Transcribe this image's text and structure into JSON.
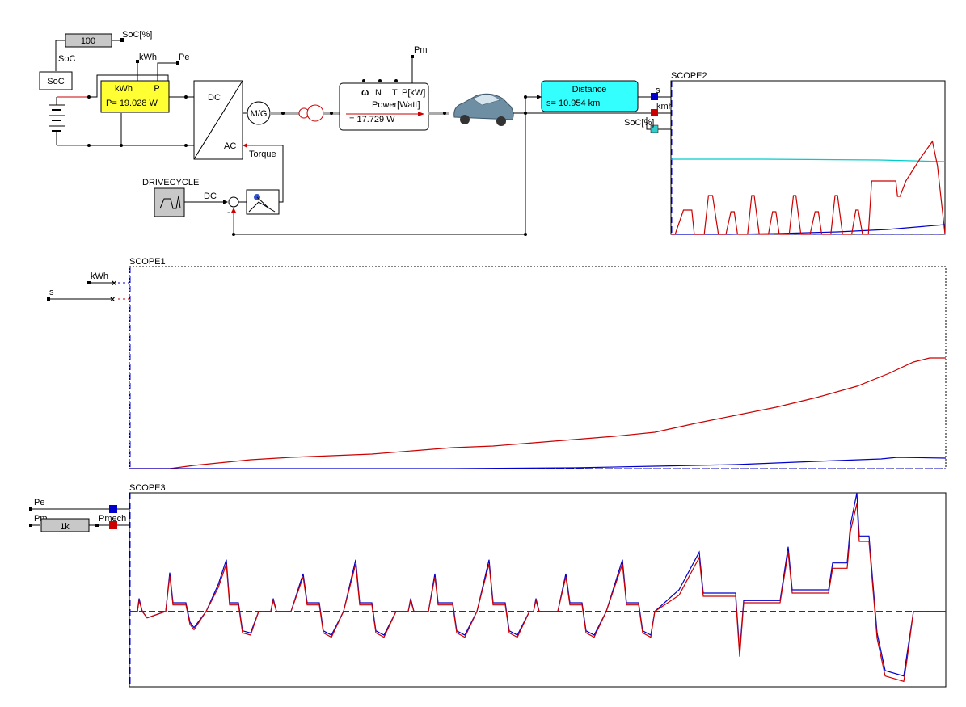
{
  "labels": {
    "soc_const": "100",
    "soc_pct_top": "SoC[%]",
    "soc_wire": "SoC",
    "soc_block": "SoC",
    "kwh_top": "kWh",
    "pe_top": "Pe",
    "meter_kwh": "kWh",
    "meter_p": "P",
    "meter_value": "P= 19.028 W",
    "conv_dc": "DC",
    "conv_ac": "AC",
    "motor": "M/G",
    "torque": "Torque",
    "pm_top": "Pm",
    "sensor_omega": "ω",
    "sensor_n": "N",
    "sensor_t": "T",
    "sensor_pkw": "P[kW]",
    "power_label": "Power[Watt]",
    "power_value": "= 17.729 W",
    "distance_title": "Distance",
    "distance_value": "s= 10.954 km",
    "out_s": "s",
    "out_kmh": "kmh",
    "out_soc": "SoC[%]",
    "drivecycle": "DRIVECYCLE",
    "dc_wire": "DC",
    "minus": "-",
    "scope1_in_kwh": "kWh",
    "scope1_in_s": "s",
    "scope3_in_pe": "Pe",
    "scope3_in_pm": "Pm",
    "scope3_gain": "1k",
    "scope3_in_pmech": "Pmech"
  },
  "colors": {
    "red": "#cc0000",
    "blue": "#0000cc",
    "cyan": "#00cccc",
    "meter_fill": "#ffff33",
    "distance_fill": "#33ffff",
    "gray_block": "#c8c8c8"
  },
  "chart_data": [
    {
      "type": "line",
      "title": "SCOPE2",
      "xlim": [
        0,
        329
      ],
      "ylim": [
        0,
        190
      ],
      "grid": false,
      "series": [
        {
          "color": "#00cccc",
          "points": [
            [
              0,
              93
            ],
            [
              110,
              93
            ],
            [
              250,
              92
            ],
            [
              329,
              90
            ]
          ]
        },
        {
          "color": "#0000cc",
          "points": [
            [
              0,
              0
            ],
            [
              70,
              0
            ],
            [
              130,
              1
            ],
            [
              200,
              3
            ],
            [
              260,
              6
            ],
            [
              329,
              12
            ]
          ]
        },
        {
          "color": "#cc0000",
          "points": [
            [
              0,
              0
            ],
            [
              5,
              0
            ],
            [
              15,
              30
            ],
            [
              25,
              30
            ],
            [
              28,
              0
            ],
            [
              40,
              0
            ],
            [
              45,
              48
            ],
            [
              50,
              48
            ],
            [
              57,
              0
            ],
            [
              66,
              0
            ],
            [
              72,
              28
            ],
            [
              76,
              28
            ],
            [
              80,
              0
            ],
            [
              92,
              0
            ],
            [
              97,
              48
            ],
            [
              100,
              48
            ],
            [
              106,
              0
            ],
            [
              117,
              0
            ],
            [
              122,
              28
            ],
            [
              126,
              28
            ],
            [
              130,
              0
            ],
            [
              142,
              0
            ],
            [
              147,
              48
            ],
            [
              150,
              48
            ],
            [
              156,
              0
            ],
            [
              167,
              0
            ],
            [
              173,
              28
            ],
            [
              177,
              28
            ],
            [
              181,
              0
            ],
            [
              192,
              0
            ],
            [
              197,
              48
            ],
            [
              200,
              48
            ],
            [
              206,
              0
            ],
            [
              217,
              0
            ],
            [
              222,
              30
            ],
            [
              225,
              30
            ],
            [
              230,
              0
            ],
            [
              237,
              0
            ],
            [
              241,
              66
            ],
            [
              270,
              66
            ],
            [
              272,
              47
            ],
            [
              275,
              47
            ],
            [
              282,
              66
            ],
            [
              300,
              95
            ],
            [
              314,
              115
            ],
            [
              320,
              85
            ],
            [
              329,
              0
            ]
          ]
        }
      ]
    },
    {
      "type": "line",
      "title": "SCOPE1",
      "xlim": [
        0,
        1010
      ],
      "ylim": [
        0,
        250
      ],
      "grid": false,
      "series": [
        {
          "color": "#cc0000",
          "points": [
            [
              0,
              0
            ],
            [
              50,
              0
            ],
            [
              80,
              4
            ],
            [
              110,
              7
            ],
            [
              150,
              11
            ],
            [
              200,
              14
            ],
            [
              250,
              16
            ],
            [
              300,
              18
            ],
            [
              350,
              22
            ],
            [
              400,
              26
            ],
            [
              450,
              28
            ],
            [
              500,
              32
            ],
            [
              550,
              36
            ],
            [
              600,
              40
            ],
            [
              650,
              45
            ],
            [
              700,
              56
            ],
            [
              750,
              66
            ],
            [
              800,
              76
            ],
            [
              850,
              88
            ],
            [
              900,
              102
            ],
            [
              940,
              118
            ],
            [
              970,
              132
            ],
            [
              990,
              137
            ],
            [
              1010,
              137
            ]
          ]
        },
        {
          "color": "#0000cc",
          "points": [
            [
              0,
              0
            ],
            [
              200,
              0
            ],
            [
              400,
              0
            ],
            [
              550,
              1
            ],
            [
              650,
              3
            ],
            [
              750,
              5
            ],
            [
              850,
              9
            ],
            [
              930,
              12
            ],
            [
              950,
              14
            ],
            [
              1010,
              13
            ]
          ]
        }
      ]
    },
    {
      "type": "line",
      "title": "SCOPE3",
      "xlim": [
        0,
        1010
      ],
      "ylim": [
        -70,
        110
      ],
      "grid": false,
      "series": [
        {
          "color": "#0000cc",
          "points": [
            [
              0,
              0
            ],
            [
              10,
              0
            ],
            [
              12,
              12
            ],
            [
              16,
              0
            ],
            [
              22,
              -6
            ],
            [
              45,
              0
            ],
            [
              50,
              36
            ],
            [
              54,
              8
            ],
            [
              70,
              8
            ],
            [
              75,
              -10
            ],
            [
              80,
              -15
            ],
            [
              95,
              0
            ],
            [
              110,
              25
            ],
            [
              120,
              48
            ],
            [
              124,
              8
            ],
            [
              135,
              8
            ],
            [
              140,
              -18
            ],
            [
              150,
              -20
            ],
            [
              160,
              0
            ],
            [
              175,
              0
            ],
            [
              178,
              12
            ],
            [
              182,
              0
            ],
            [
              200,
              0
            ],
            [
              215,
              35
            ],
            [
              220,
              8
            ],
            [
              235,
              8
            ],
            [
              240,
              -18
            ],
            [
              250,
              -22
            ],
            [
              265,
              0
            ],
            [
              280,
              48
            ],
            [
              285,
              8
            ],
            [
              300,
              8
            ],
            [
              305,
              -18
            ],
            [
              315,
              -22
            ],
            [
              330,
              0
            ],
            [
              345,
              0
            ],
            [
              348,
              12
            ],
            [
              352,
              0
            ],
            [
              370,
              0
            ],
            [
              378,
              35
            ],
            [
              382,
              8
            ],
            [
              400,
              8
            ],
            [
              405,
              -18
            ],
            [
              415,
              -22
            ],
            [
              430,
              0
            ],
            [
              445,
              48
            ],
            [
              450,
              8
            ],
            [
              465,
              8
            ],
            [
              470,
              -18
            ],
            [
              480,
              -22
            ],
            [
              495,
              0
            ],
            [
              500,
              0
            ],
            [
              503,
              12
            ],
            [
              507,
              0
            ],
            [
              530,
              0
            ],
            [
              540,
              35
            ],
            [
              545,
              8
            ],
            [
              560,
              8
            ],
            [
              565,
              -18
            ],
            [
              575,
              -22
            ],
            [
              590,
              0
            ],
            [
              610,
              48
            ],
            [
              615,
              8
            ],
            [
              630,
              8
            ],
            [
              635,
              -18
            ],
            [
              645,
              -22
            ],
            [
              650,
              0
            ],
            [
              680,
              20
            ],
            [
              705,
              55
            ],
            [
              710,
              17
            ],
            [
              750,
              17
            ],
            [
              755,
              -38
            ],
            [
              760,
              10
            ],
            [
              805,
              10
            ],
            [
              815,
              60
            ],
            [
              820,
              20
            ],
            [
              865,
              20
            ],
            [
              870,
              45
            ],
            [
              888,
              45
            ],
            [
              892,
              80
            ],
            [
              900,
              110
            ],
            [
              903,
              70
            ],
            [
              915,
              70
            ],
            [
              925,
              -20
            ],
            [
              935,
              -55
            ],
            [
              958,
              -60
            ],
            [
              962,
              -40
            ],
            [
              970,
              0
            ],
            [
              1010,
              0
            ]
          ]
        },
        {
          "color": "#cc0000",
          "points": [
            [
              0,
              0
            ],
            [
              10,
              0
            ],
            [
              12,
              10
            ],
            [
              16,
              0
            ],
            [
              22,
              -6
            ],
            [
              45,
              0
            ],
            [
              50,
              33
            ],
            [
              54,
              6
            ],
            [
              70,
              6
            ],
            [
              75,
              -12
            ],
            [
              80,
              -17
            ],
            [
              95,
              0
            ],
            [
              110,
              22
            ],
            [
              120,
              44
            ],
            [
              124,
              6
            ],
            [
              135,
              6
            ],
            [
              140,
              -20
            ],
            [
              150,
              -22
            ],
            [
              160,
              0
            ],
            [
              175,
              0
            ],
            [
              178,
              10
            ],
            [
              182,
              0
            ],
            [
              200,
              0
            ],
            [
              215,
              32
            ],
            [
              220,
              6
            ],
            [
              235,
              6
            ],
            [
              240,
              -20
            ],
            [
              250,
              -24
            ],
            [
              265,
              0
            ],
            [
              280,
              44
            ],
            [
              285,
              6
            ],
            [
              300,
              6
            ],
            [
              305,
              -20
            ],
            [
              315,
              -24
            ],
            [
              330,
              0
            ],
            [
              345,
              0
            ],
            [
              348,
              10
            ],
            [
              352,
              0
            ],
            [
              370,
              0
            ],
            [
              378,
              32
            ],
            [
              382,
              6
            ],
            [
              400,
              6
            ],
            [
              405,
              -20
            ],
            [
              415,
              -24
            ],
            [
              430,
              0
            ],
            [
              445,
              44
            ],
            [
              450,
              6
            ],
            [
              465,
              6
            ],
            [
              470,
              -20
            ],
            [
              480,
              -24
            ],
            [
              495,
              0
            ],
            [
              500,
              0
            ],
            [
              503,
              10
            ],
            [
              507,
              0
            ],
            [
              530,
              0
            ],
            [
              540,
              32
            ],
            [
              545,
              6
            ],
            [
              560,
              6
            ],
            [
              565,
              -20
            ],
            [
              575,
              -24
            ],
            [
              590,
              0
            ],
            [
              610,
              44
            ],
            [
              615,
              6
            ],
            [
              630,
              6
            ],
            [
              635,
              -20
            ],
            [
              645,
              -24
            ],
            [
              650,
              0
            ],
            [
              680,
              15
            ],
            [
              705,
              50
            ],
            [
              710,
              14
            ],
            [
              750,
              14
            ],
            [
              755,
              -42
            ],
            [
              760,
              8
            ],
            [
              805,
              8
            ],
            [
              815,
              55
            ],
            [
              820,
              17
            ],
            [
              865,
              17
            ],
            [
              870,
              40
            ],
            [
              888,
              40
            ],
            [
              892,
              74
            ],
            [
              900,
              100
            ],
            [
              903,
              65
            ],
            [
              915,
              65
            ],
            [
              925,
              -25
            ],
            [
              935,
              -60
            ],
            [
              958,
              -65
            ],
            [
              962,
              -45
            ],
            [
              970,
              0
            ],
            [
              1010,
              0
            ]
          ]
        }
      ]
    }
  ]
}
